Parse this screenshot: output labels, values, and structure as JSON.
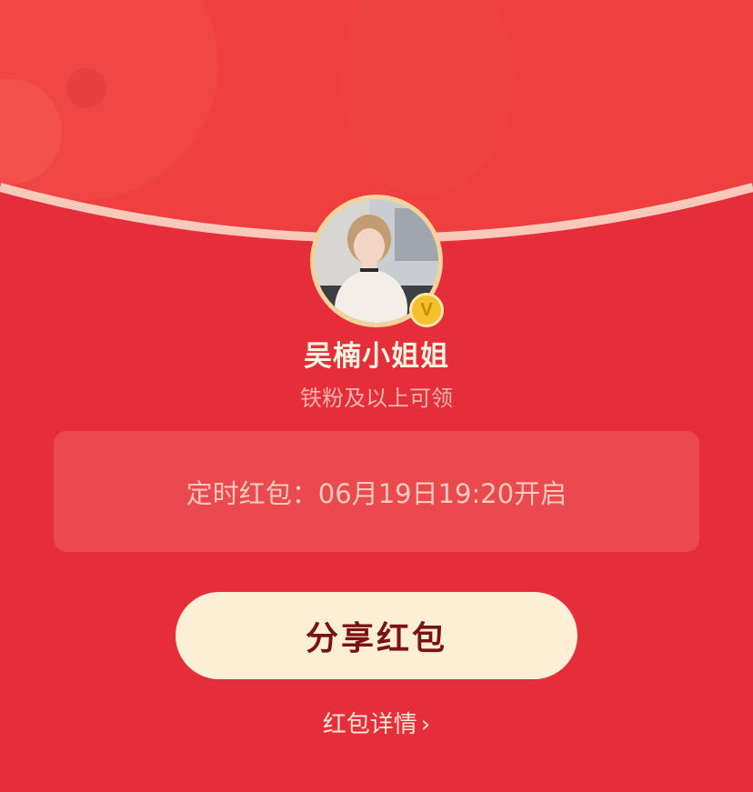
{
  "sender": {
    "name": "吴楠小姐姐",
    "condition": "铁粉及以上可领",
    "badge": "V"
  },
  "timer": {
    "text": "定时红包：06月19日19:20开启"
  },
  "actions": {
    "share_label": "分享红包",
    "details_label": "红包详情",
    "details_icon": "chevron-right-icon"
  },
  "colors": {
    "background": "#E62E3A",
    "header": "#EF3F40",
    "button": "#FDEED6",
    "button_text": "#7A1212",
    "badge": "#F3C12D"
  }
}
